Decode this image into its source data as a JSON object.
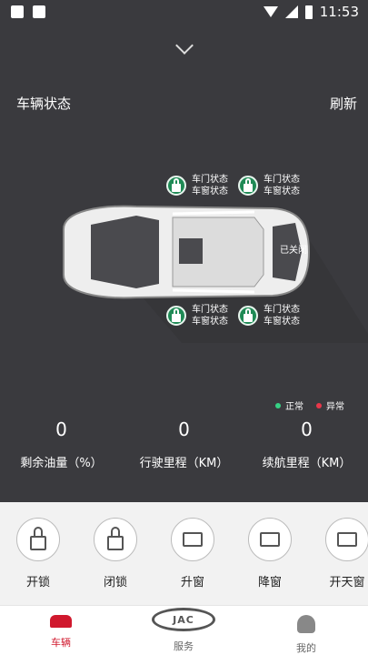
{
  "status_bar": {
    "time": "11:53"
  },
  "vehicle": {
    "title": "车辆状态",
    "refresh_label": "刷新",
    "doors": {
      "front_left": {
        "door": "车门状态",
        "window": "车窗状态"
      },
      "rear_left": {
        "door": "车门状态",
        "window": "车窗状态"
      },
      "front_right": {
        "door": "车门状态",
        "window": "车窗状态"
      },
      "rear_right": {
        "door": "车门状态",
        "window": "车窗状态"
      }
    },
    "trunk_status": "已关闭",
    "legend": {
      "normal": "正常",
      "abnormal": "异常",
      "normal_color": "#36d184",
      "abnormal_color": "#e8374a"
    },
    "stats": [
      {
        "value": "0",
        "label": "剩余油量（%）"
      },
      {
        "value": "0",
        "label": "行驶里程（KM）"
      },
      {
        "value": "0",
        "label": "续航里程（KM）"
      }
    ]
  },
  "actions": [
    {
      "label": "开锁",
      "icon": "unlock-icon"
    },
    {
      "label": "闭锁",
      "icon": "lock-icon"
    },
    {
      "label": "升窗",
      "icon": "window-up-icon"
    },
    {
      "label": "降窗",
      "icon": "window-down-icon"
    },
    {
      "label": "开天窗",
      "icon": "sunroof-icon"
    }
  ],
  "tabbar": {
    "car": "车辆",
    "service": "服务",
    "me": "我的",
    "logo_text": "JAC",
    "active_color": "#d0182d"
  }
}
